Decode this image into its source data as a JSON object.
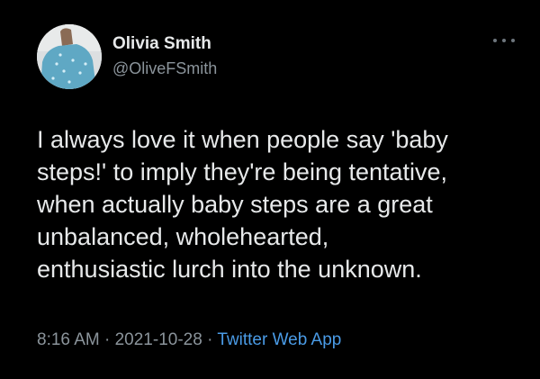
{
  "author": {
    "display_name": "Olivia Smith",
    "handle": "@OliveFSmith",
    "avatar_icon": "profile-photo"
  },
  "more_icon": "ellipsis-icon",
  "tweet": {
    "lines": [
      "I always love it when people say 'baby",
      "steps!' to imply they're being tentative,",
      "when actually baby steps are a great",
      "unbalanced, wholehearted,",
      "enthusiastic lurch into the unknown."
    ],
    "time": "8:16 AM",
    "separator": " · ",
    "date": "2021-10-28",
    "source": "Twitter Web App"
  },
  "colors": {
    "background": "#000000",
    "primary_text": "#e7e9ea",
    "secondary_text": "#8b949b",
    "link": "#4a9be6"
  }
}
